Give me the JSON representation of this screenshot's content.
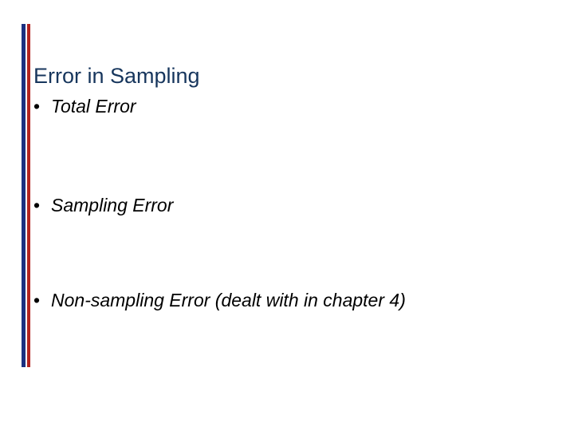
{
  "title": "Error in Sampling",
  "items": [
    "Total Error",
    "Sampling Error",
    "Non-sampling Error (dealt with in chapter 4)"
  ]
}
